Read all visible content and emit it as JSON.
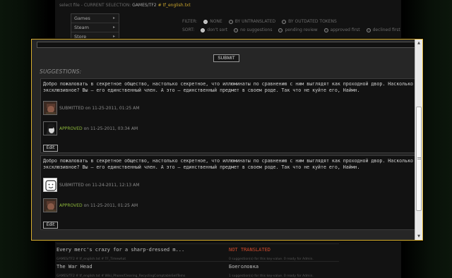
{
  "background": {
    "topbar": {
      "prefix": "select file - CURRENT SELECTION:",
      "path": "GAMES/TF2",
      "separator": "#",
      "file": "tf_english.txt"
    },
    "menu": [
      {
        "label": "Games",
        "arrow": "▸"
      },
      {
        "label": "Steam",
        "arrow": "▸"
      },
      {
        "label": "Store",
        "arrow": "▸"
      }
    ],
    "filter": {
      "label": "FILTER:",
      "options": [
        "NONE",
        "BY UNTRANSLATED",
        "BY OUTDATED TOKENS"
      ],
      "selected": 0
    },
    "sort": {
      "label": "SORT:",
      "options": [
        "don't sort",
        "no suggestions",
        "pending review",
        "approved first",
        "declined first"
      ],
      "selected": 0
    },
    "rows": [
      {
        "source": "Every merc's crazy for a sharp-dressed m...",
        "status": "NOT TRANSLATED",
        "meta_left": "GAMES/TF2 # tf_english.txt # TF_Timewhat",
        "meta_right": "0 suggestion(s) for this key-value. 0 ready for Admin."
      },
      {
        "source": "The War Head",
        "translation": "Боеголовка",
        "meta_left": "GAMES/TF2 # tf_english.txt # Wiki_Phone/Clearing_RecyclingComptableSellTems",
        "meta_right": "1 suggestion(s) for this key-value. 0 ready for Admin."
      }
    ]
  },
  "modal": {
    "submit_label": "SUBMIT",
    "suggestions_label": "SUGGESTIONS:",
    "cards": [
      {
        "text": "Добро пожаловать в секретное общество, настолько секретное, что иллюминаты по сравнению с ним выглядят как проходной двор. Насколько эксклюзивное? Вы – его единственный член. А это – единственный предмет в своем роде. Так что не куйте его, Наймн.",
        "entries": [
          {
            "status": "SUBMITTED",
            "on": "on",
            "date": "11-25-2011, 01:25 AM",
            "avatar": "soldier-avatar"
          },
          {
            "status": "APPROVED",
            "on": "on",
            "date": "11-25-2011, 03:34 AM",
            "avatar": "anime-avatar"
          }
        ],
        "edit_label": "Edit"
      },
      {
        "text": "Добро пожаловать в секретное общество, настолько секретное, что иллюминаты по сравнению с ним выглядят как проходной двор. Насколько эксклюзивное? Вы – его единственный член. А это – единственный предмет в своем роде. Так что не куйте его, Наймн.",
        "entries": [
          {
            "status": "SUBMITTED",
            "on": "on",
            "date": "11-24-2011, 12:13 AM",
            "avatar": "smiley-avatar"
          },
          {
            "status": "APPROVED",
            "on": "on",
            "date": "11-25-2011, 01:25 AM",
            "avatar": "soldier-avatar"
          }
        ],
        "edit_label": "Edit"
      }
    ],
    "scrollbar": {
      "up": "▲",
      "down": "▼"
    }
  },
  "colors": {
    "accent": "#d8b030",
    "approved": "#8db83a",
    "not_translated": "#d04a2c"
  }
}
